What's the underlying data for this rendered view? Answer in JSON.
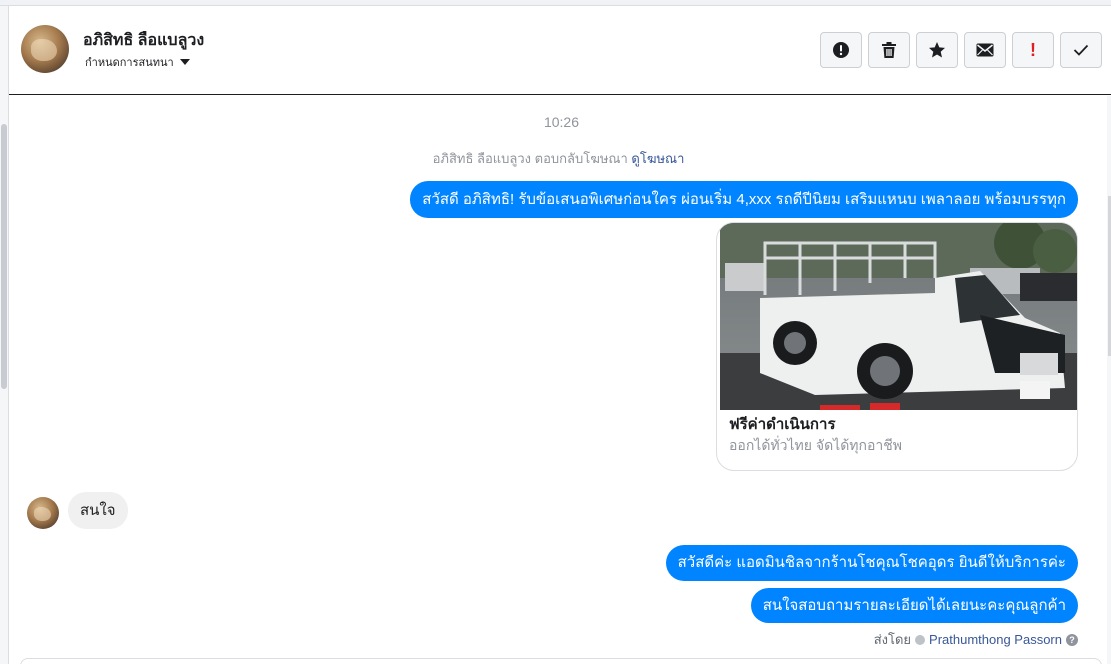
{
  "header": {
    "contact_name": "อภิสิทธิ ลือแบลูวง",
    "conversation_settings": "กำหนดการสนทนา",
    "actions": [
      {
        "name": "report-icon",
        "interactable": true
      },
      {
        "name": "trash-icon",
        "interactable": true
      },
      {
        "name": "star-icon",
        "interactable": true
      },
      {
        "name": "mail-icon",
        "interactable": true
      },
      {
        "name": "important-icon",
        "interactable": true,
        "glyph": "!"
      },
      {
        "name": "checkmark-icon",
        "interactable": true
      }
    ]
  },
  "thread": {
    "timestamp": "10:26",
    "ad_reply": {
      "text": "อภิสิทธิ ลือแบลูวง ตอบกลับโฆษณา",
      "link": "ดูโฆษณา"
    },
    "messages": [
      {
        "direction": "outgoing",
        "text": "สวัสดี อภิสิทธิ! รับข้อเสนอพิเศษก่อนใคร ผ่อนเริ่ม 4,xxx รถดีปีนิยม เสริมแหนบ เพลาลอย พร้อมบรรทุก"
      },
      {
        "direction": "incoming",
        "text": "สนใจ"
      },
      {
        "direction": "outgoing",
        "text": "สวัสดีค่ะ แอดมินชิลจากร้านโชคุณโชคอุดร ยินดีให้บริการค่ะ"
      },
      {
        "direction": "outgoing",
        "text": "สนใจสอบถามรายละเอียดได้เลยนะคะคุณลูกค้า"
      }
    ],
    "card": {
      "image": "white-pickup-truck-photo",
      "title": "ฟรีค่าดำเนินการ",
      "subtitle": "ออกได้ทั่วไทย จัดได้ทุกอาชีพ"
    },
    "sent_by": {
      "label": "ส่งโดย",
      "name": "Prathumthong Passorn"
    }
  },
  "colors": {
    "outgoing_bubble": "#0084ff",
    "incoming_bubble": "#f1f0f0",
    "link": "#385898",
    "important": "#e02020"
  }
}
